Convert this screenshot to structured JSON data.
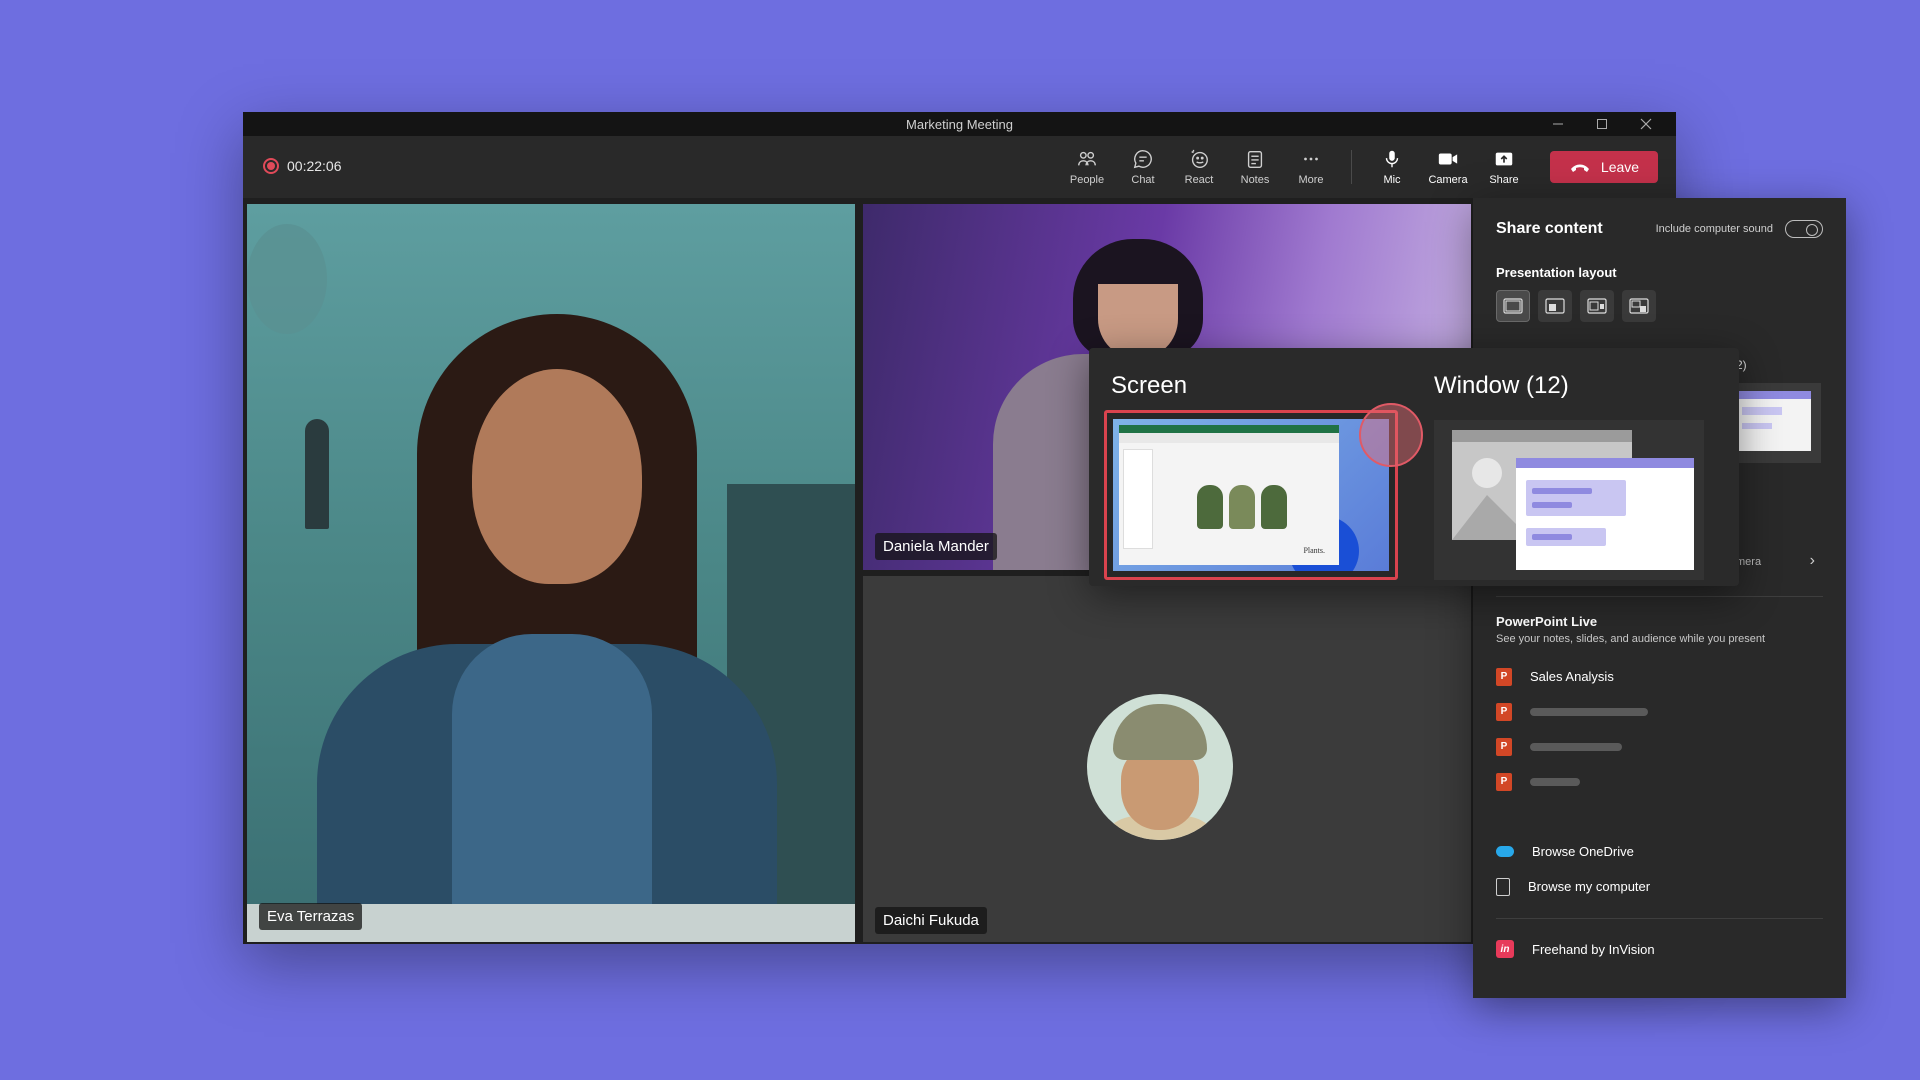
{
  "window": {
    "title": "Marketing Meeting",
    "controls": {
      "minimize": "–",
      "maximize": "□",
      "close": "✕"
    }
  },
  "toolbar": {
    "recording_time": "00:22:06",
    "tools": [
      {
        "label": "People",
        "icon": "people-icon"
      },
      {
        "label": "Chat",
        "icon": "chat-icon"
      },
      {
        "label": "React",
        "icon": "react-icon"
      },
      {
        "label": "Notes",
        "icon": "notes-icon"
      },
      {
        "label": "More",
        "icon": "more-icon"
      },
      {
        "label": "Mic",
        "icon": "mic-icon"
      },
      {
        "label": "Camera",
        "icon": "camera-icon"
      },
      {
        "label": "Share",
        "icon": "share-icon"
      }
    ],
    "leave_label": "Leave",
    "leave_color": "#c4314b"
  },
  "participants": [
    {
      "name": "Eva Terrazas"
    },
    {
      "name": "Daniela Mander"
    },
    {
      "name": "Daichi Fukuda"
    }
  ],
  "share_panel": {
    "title": "Share content",
    "include_sound_label": "Include computer sound",
    "include_sound_on": false,
    "layout_label": "Presentation layout",
    "partial_window_label": "2)",
    "partial_camera_label": "mera",
    "powerpoint": {
      "title": "PowerPoint Live",
      "subtitle": "See your notes, slides, and audience while you present",
      "files": [
        "Sales Analysis"
      ]
    },
    "browse": [
      {
        "label": "Browse OneDrive",
        "icon": "onedrive-icon"
      },
      {
        "label": "Browse my computer",
        "icon": "computer-icon"
      }
    ],
    "apps": [
      {
        "label": "Freehand by InVision",
        "icon": "invision-icon"
      }
    ]
  },
  "picker": {
    "screen_label": "Screen",
    "window_label": "Window (12)",
    "screen_thumb_caption": "Plants."
  },
  "colors": {
    "background": "#6e6ee0",
    "selection_border": "#d9434e",
    "recording": "#e04a59"
  }
}
